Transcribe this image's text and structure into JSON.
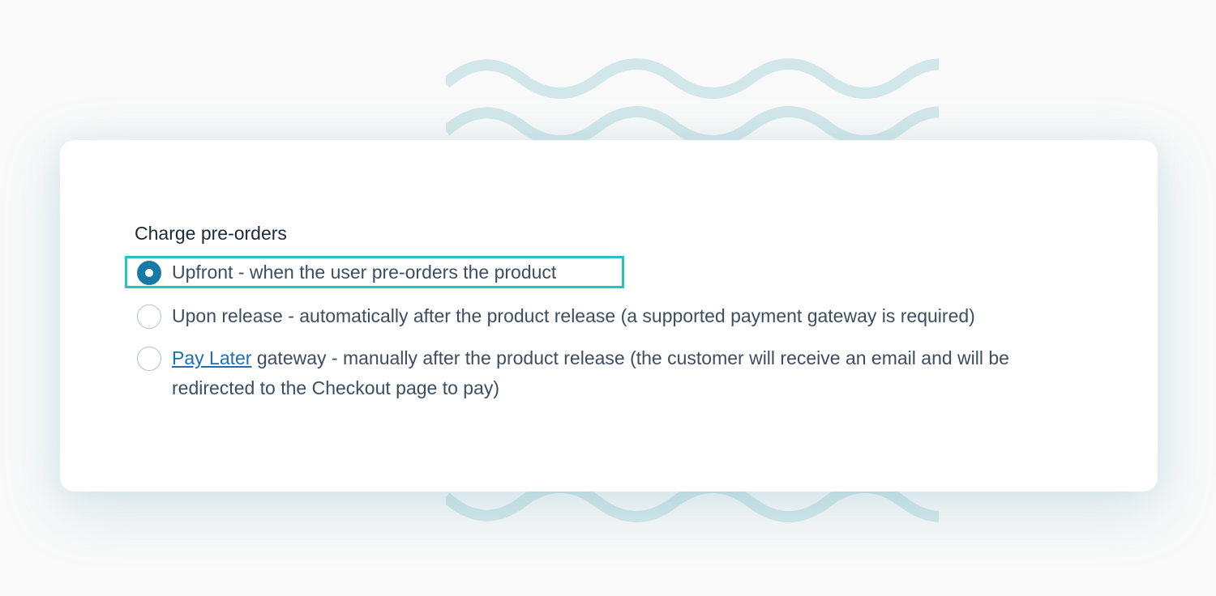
{
  "colors": {
    "accent": "#167aa6",
    "highlight_border": "#24c3c4",
    "link": "#1f6fb0",
    "wave": "#d2e7ea"
  },
  "form": {
    "group_label": "Charge pre-orders",
    "selected_option": "upfront",
    "options": [
      {
        "id": "upfront",
        "label": "Upfront - when the user pre-orders the product",
        "selected": true,
        "highlighted": true
      },
      {
        "id": "upon-release",
        "label": "Upon release - automatically after the product release (a supported payment gateway is required)",
        "selected": false
      },
      {
        "id": "pay-later",
        "link_text": "Pay Later",
        "label_rest": " gateway - manually after the product release (the customer will receive an email and will be redirected to the Checkout page to pay)",
        "selected": false
      }
    ]
  }
}
